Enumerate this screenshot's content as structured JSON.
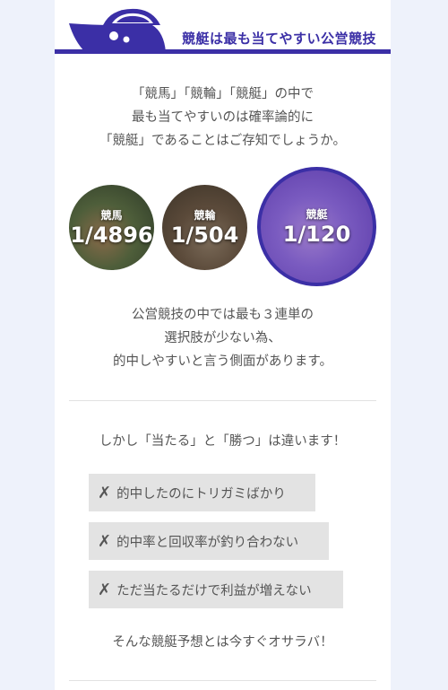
{
  "header": {
    "title": "競艇は最も当てやすい公営競技",
    "accent_color": "#3b2fa6",
    "icon": "boat-icon"
  },
  "intro": {
    "lines": [
      "「競馬」「競輪」「競艇」の中で",
      "最も当てやすいのは確率論的に",
      "「競艇」であることはご存知でしょうか。"
    ]
  },
  "odds": [
    {
      "label": "競馬",
      "value": "1/4896"
    },
    {
      "label": "競輪",
      "value": "1/504"
    },
    {
      "label": "競艇",
      "value": "1/120"
    }
  ],
  "description": {
    "lines": [
      "公営競技の中では最も３連単の",
      "選択肢が少ない為、",
      "的中しやすいと言う側面があります。"
    ]
  },
  "lead": "しかし「当たる」と「勝つ」は違います！",
  "problems": {
    "mark": "✗",
    "items": [
      "的中したのにトリガミばかり",
      "的中率と回収率が釣り合わない",
      "ただ当たるだけで利益が増えない"
    ]
  },
  "outro": "そんな競艇予想とは今すぐオサラバ！"
}
